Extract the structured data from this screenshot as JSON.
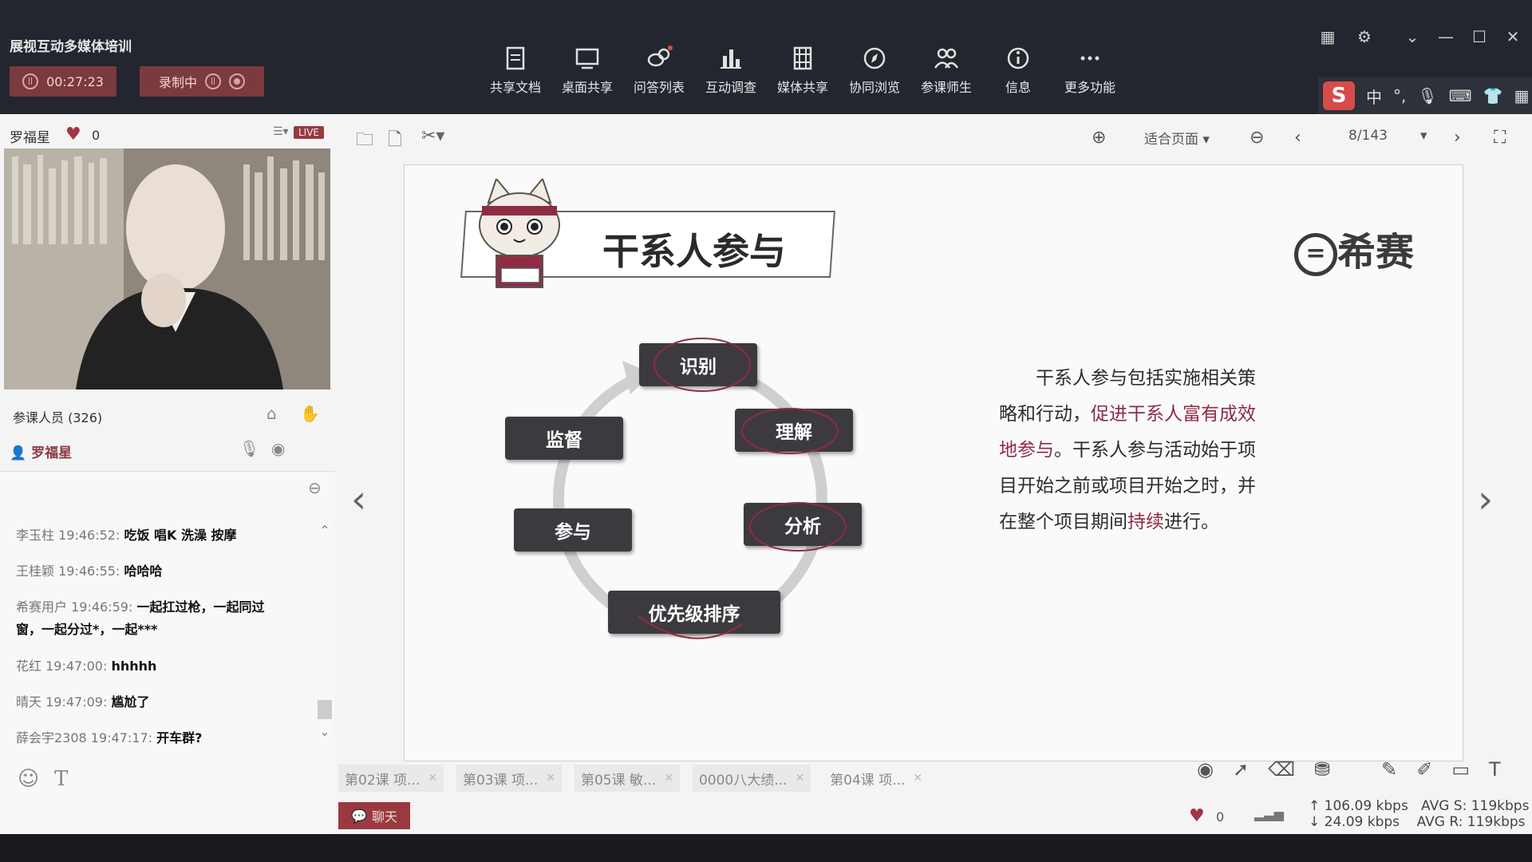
{
  "app": {
    "title": "展视互动多媒体培训",
    "timer": "00:27:23",
    "recording_label": "录制中"
  },
  "toolbar": [
    {
      "label": "共享文档",
      "icon": "document-icon"
    },
    {
      "label": "桌面共享",
      "icon": "desktop-icon"
    },
    {
      "label": "问答列表",
      "icon": "qa-icon"
    },
    {
      "label": "互动调查",
      "icon": "chart-icon"
    },
    {
      "label": "媒体共享",
      "icon": "film-icon"
    },
    {
      "label": "协同浏览",
      "icon": "compass-icon"
    },
    {
      "label": "参课师生",
      "icon": "users-icon"
    },
    {
      "label": "信息",
      "icon": "info-icon"
    },
    {
      "label": "更多功能",
      "icon": "more-icon"
    }
  ],
  "ime": {
    "lang": "中"
  },
  "presenter": {
    "name": "罗福星",
    "likes": "0",
    "live": "LIVE"
  },
  "participants": {
    "label": "参课人员 (326)",
    "host": "罗福星"
  },
  "chat": {
    "messages": [
      {
        "who": "李玉柱 19:46:52:",
        "text": "吃饭 唱K 洗澡 按摩"
      },
      {
        "who": "王桂颖 19:46:55:",
        "text": "哈哈哈"
      },
      {
        "who": "希赛用户 19:46:59:",
        "text": "一起扛过枪，一起同过窗，一起分过*，一起***"
      },
      {
        "who": "花红 19:47:00:",
        "text": "hhhhh"
      },
      {
        "who": "晴天 19:47:09:",
        "text": "尴尬了"
      },
      {
        "who": "薛会宇2308 19:47:17:",
        "text": "开车群?"
      }
    ]
  },
  "viewer": {
    "fit": "适合页面",
    "page": "8/143"
  },
  "slide": {
    "title": "干系人参与",
    "brand": "希赛",
    "cycle": [
      "识别",
      "理解",
      "分析",
      "优先级排序",
      "参与",
      "监督"
    ],
    "para_parts": [
      {
        "t": "干系人参与包括实施相关策略和行动，",
        "hl": false
      },
      {
        "t": "促进干系人富有成效地参与",
        "hl": true
      },
      {
        "t": "。干系人参与活动始于项目开始之前或项目开始之时，并在整个项目期间",
        "hl": false
      },
      {
        "t": "持续",
        "hl": true
      },
      {
        "t": "进行。",
        "hl": false
      }
    ],
    "para": "干系人参与包括实施相关策略和行动，促进干系人富有成效地参与。干系人参与活动始于项目开始之前或项目开始之时，并在整个项目期间持续进行。"
  },
  "tabs": [
    "第02课 项...",
    "第03课 项...",
    "第05课 敏...",
    "0000八大绩...",
    "第04课 项..."
  ],
  "chat_tab": "聊天",
  "stats": {
    "likes": "0",
    "up": "106.09 kbps",
    "down": "24.09 kbps",
    "avg_s": "AVG S: 119kbps",
    "avg_r": "AVG R: 119kbps"
  },
  "colors": {
    "accent": "#9a3a40",
    "dark_box": "#3d3a3f",
    "highlight": "#8e2c44"
  }
}
